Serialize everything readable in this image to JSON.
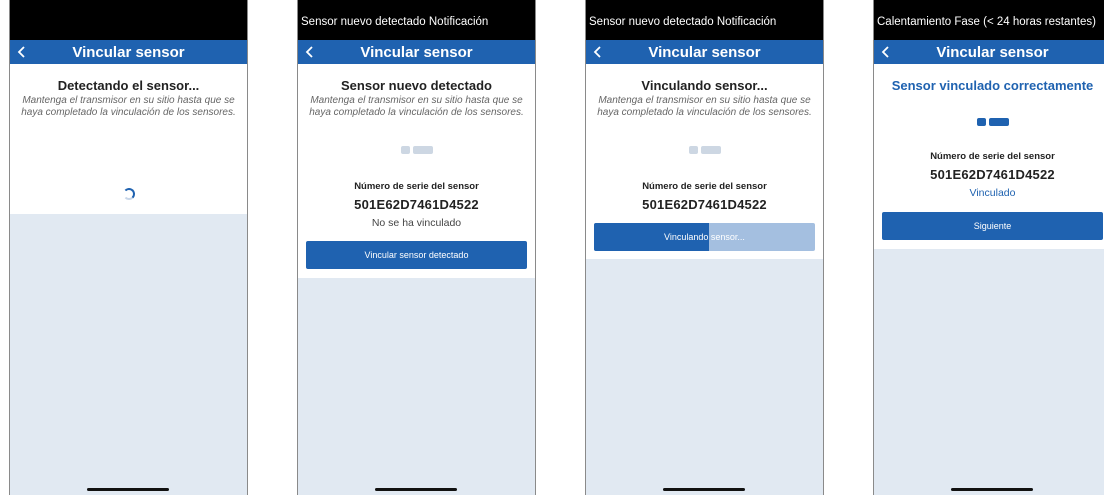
{
  "nav_title": "Vincular sensor",
  "instruction": "Mantenga el transmisor en su sitio hasta que se haya completado la vinculación de los sensores.",
  "serial_label": "Número de serie del sensor",
  "serial_number": "501E62D7461D4522",
  "colors": {
    "primary": "#1f62b0",
    "progress_track": "#a4bfe0",
    "screen_bg": "#e1e9f2"
  },
  "screens": [
    {
      "status_text": "",
      "heading": "Detectando el sensor..."
    },
    {
      "status_text": "Sensor nuevo detectado Notificación",
      "heading": "Sensor nuevo detectado",
      "state": "No se ha vinculado",
      "button": "Vincular sensor detectado"
    },
    {
      "status_text": "Sensor nuevo detectado Notificación",
      "heading": "Vinculando sensor...",
      "progress": {
        "label": "Vinculando sensor...",
        "fraction": 0.52
      }
    },
    {
      "status_text": "Calentamiento Fase (< 24 horas restantes)",
      "heading": "Sensor vinculado correctamente",
      "state": "Vinculado",
      "button": "Siguiente"
    }
  ]
}
